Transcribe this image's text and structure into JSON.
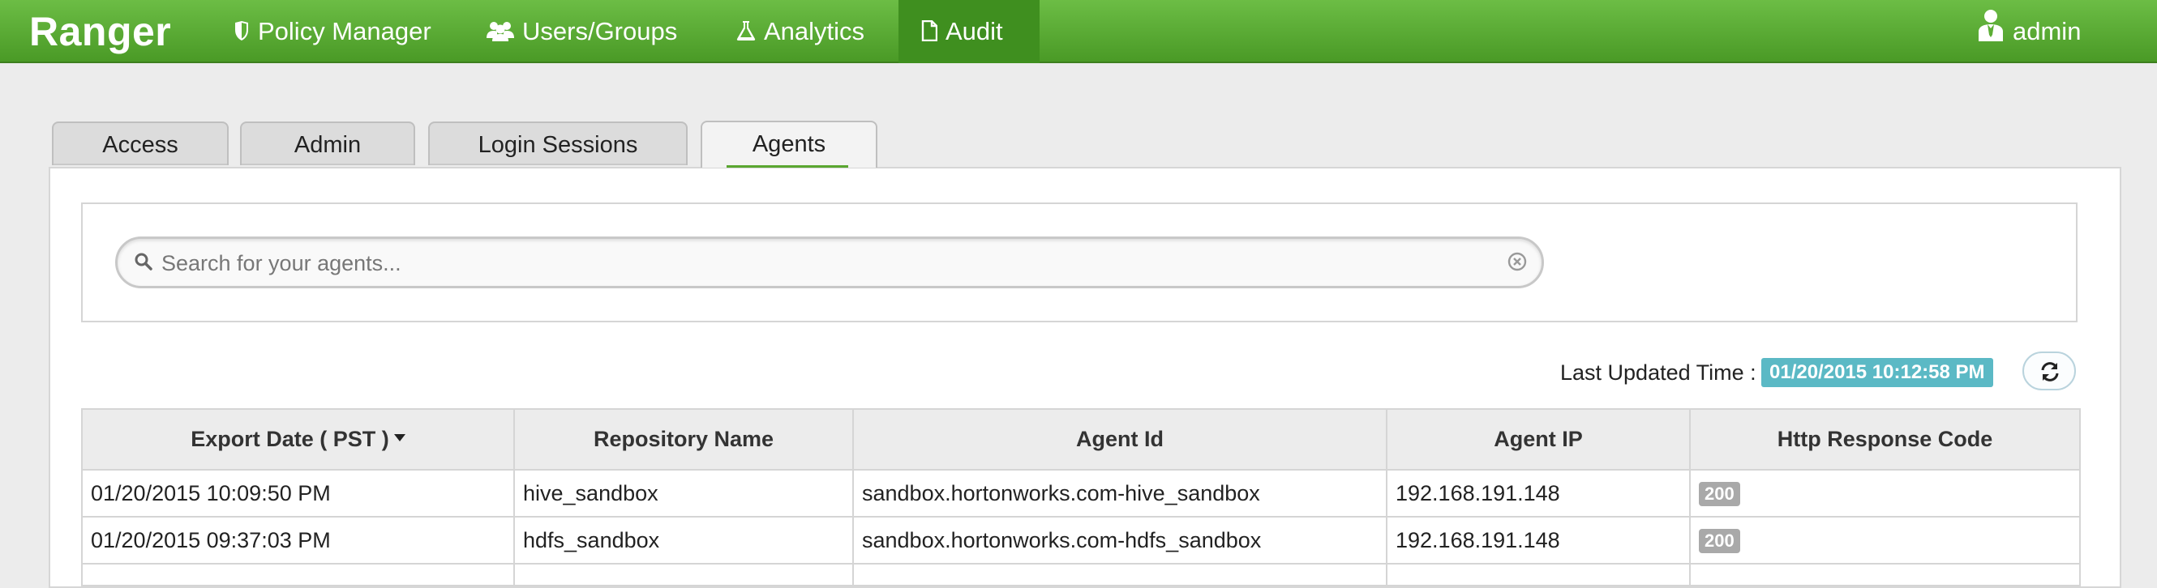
{
  "navbar": {
    "brand": "Ranger",
    "items": [
      {
        "label": "Policy Manager",
        "icon": "shield-icon"
      },
      {
        "label": "Users/Groups",
        "icon": "users-icon"
      },
      {
        "label": "Analytics",
        "icon": "flask-icon"
      },
      {
        "label": "Audit",
        "icon": "file-icon",
        "active": true
      }
    ],
    "user": {
      "label": "admin",
      "icon": "user-icon"
    }
  },
  "tabs": [
    {
      "label": "Access"
    },
    {
      "label": "Admin"
    },
    {
      "label": "Login Sessions"
    },
    {
      "label": "Agents",
      "active": true
    }
  ],
  "search": {
    "placeholder": "Search for your agents...",
    "value": ""
  },
  "status": {
    "last_updated_label": "Last Updated Time :",
    "last_updated_value": "01/20/2015 10:12:58 PM"
  },
  "table": {
    "columns": [
      "Export Date ( PST )",
      "Repository Name",
      "Agent Id",
      "Agent IP",
      "Http Response Code"
    ],
    "sorted_column": "Export Date ( PST )",
    "rows": [
      [
        "01/20/2015 10:09:50 PM",
        "hive_sandbox",
        "sandbox.hortonworks.com-hive_sandbox",
        "192.168.191.148",
        "200"
      ],
      [
        "01/20/2015 09:37:03 PM",
        "hdfs_sandbox",
        "sandbox.hortonworks.com-hdfs_sandbox",
        "192.168.191.148",
        "200"
      ]
    ]
  },
  "colors": {
    "navbar_green": "#5cae35",
    "active_nav": "#3f8f1f",
    "time_badge": "#5bb9c5",
    "code_badge": "#a9a9a9"
  }
}
